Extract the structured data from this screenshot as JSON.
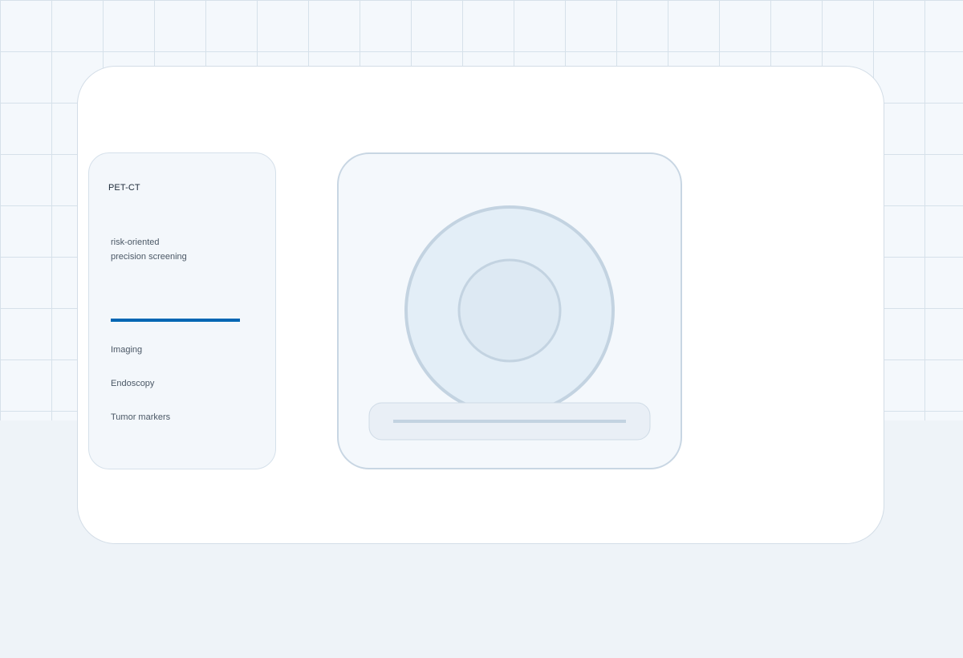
{
  "panel": {
    "title": "PET-CT",
    "description_lines": [
      "risk-oriented",
      "precision screening"
    ],
    "categories": [
      "Imaging",
      "Endoscopy",
      "Tumor markers"
    ]
  },
  "illustration": {
    "icon": "pet-ct-scanner-icon"
  },
  "colors": {
    "accent": "#0066b3",
    "page_background": "#eef3f8",
    "grid_line": "#d6e1ea",
    "card_background": "#ffffff",
    "scanner_stroke": "#c3d3e1",
    "scanner_fill": "#e3eef7"
  }
}
